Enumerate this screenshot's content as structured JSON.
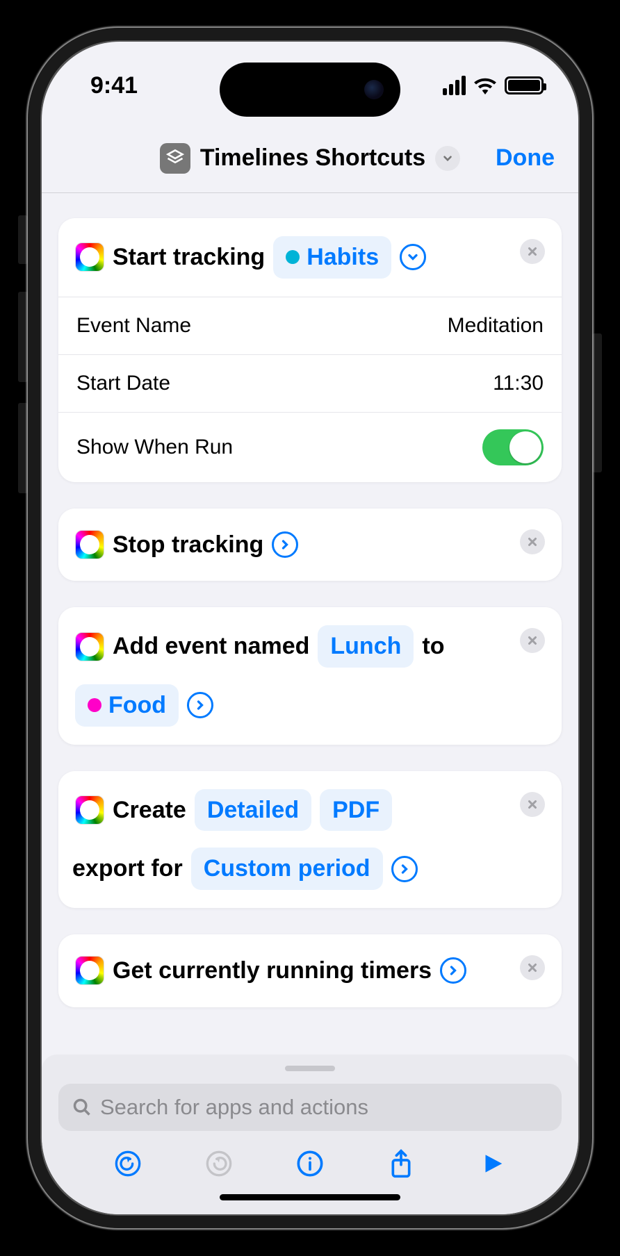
{
  "status": {
    "time": "9:41"
  },
  "header": {
    "title": "Timelines Shortcuts",
    "done": "Done"
  },
  "actions": [
    {
      "verb": "Start tracking",
      "tag": "Habits",
      "tag_color": "#00b3d7",
      "expanded": true,
      "expand_icon": "chevron-down",
      "rows": [
        {
          "label": "Event Name",
          "value": "Meditation",
          "type": "text"
        },
        {
          "label": "Start Date",
          "value": "11:30",
          "type": "text"
        },
        {
          "label": "Show When Run",
          "value": "on",
          "type": "toggle"
        }
      ]
    },
    {
      "verb": "Stop tracking",
      "expand_icon": "chevron-right"
    },
    {
      "parts": [
        "Add event named",
        "Lunch",
        "to"
      ],
      "tag": "Food",
      "tag_color": "#ff00c8",
      "expand_icon": "chevron-right"
    },
    {
      "parts": [
        "Create",
        "Detailed",
        "PDF",
        "export for",
        "Custom period"
      ],
      "token_idx": [
        1,
        2,
        4
      ],
      "expand_icon": "chevron-right"
    },
    {
      "verb": "Get currently running timers",
      "expand_icon": "chevron-right"
    }
  ],
  "search": {
    "placeholder": "Search for apps and actions"
  }
}
